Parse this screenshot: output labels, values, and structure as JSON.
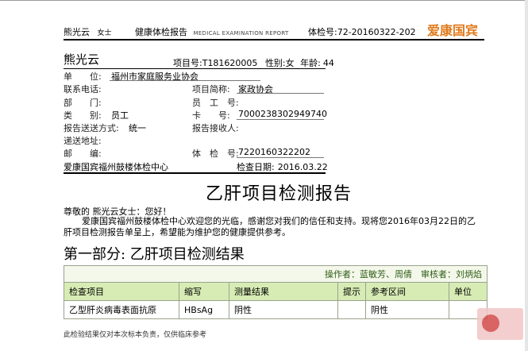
{
  "header": {
    "patient_name": "熊光云",
    "honorific": "女士",
    "report_title": "健康体检报告",
    "report_title_en": "MEDICAL EXAMINATION REPORT",
    "exam_no_label": "体检号:",
    "exam_no": "72-20160322-202",
    "brand": "爱康国宾"
  },
  "info": {
    "name": "熊光云",
    "project_no_label": "项目号:",
    "project_no": "T181620005",
    "gender_label": "性别:",
    "gender": "女",
    "age_label": "年龄:",
    "age": "44",
    "unit_label": "单　　位:",
    "unit": "福州市家庭服务业协会",
    "phone_label": "联系电话:",
    "project_short_label": "项目简称:",
    "project_short": "家政协会",
    "dept_label": "部　　门:",
    "employee_no_label": "员　工　号:",
    "category_label": "类　　别:",
    "category": "员工",
    "card_no_label": "卡　　号:",
    "card_no": "7000238302949740",
    "delivery_label": "报告送送方式:",
    "delivery": "统一",
    "receiver_label": "报告接收人:",
    "address_label": "递送地址:",
    "postcode_label": "邮　　编:",
    "exam_no2_label": "体　检　号:",
    "exam_no2": "7220160322202",
    "center": "爱康国宾福州鼓楼体检中心",
    "exam_date_label": "检查日期:",
    "exam_date": "2016.03.22"
  },
  "main": {
    "title": "乙肝项目检测报告",
    "greeting": "尊敬的 熊光云女士：您好！",
    "intro_line1": "爱康国宾福州鼓楼体检中心欢迎您的光临，感谢您对我们的信任和支持。现将您2016年03月22日的乙",
    "intro_line2": "肝项目检测报告单呈上，希望能为维护您的健康提供参考。",
    "section_title": "第一部分:  乙肝项目检测结果",
    "authors": "操作者：蓝敏芳、周倩　审核者：刘炳焰",
    "footnote": "此检验结果仅对本次标本负责，仅供临床参考"
  },
  "table": {
    "headers": [
      "检查项目",
      "缩写",
      "测量结果",
      "提示",
      "参考区间",
      "单位"
    ],
    "rows": [
      [
        "乙型肝炎病毒表面抗原",
        "HBsAg",
        "阴性",
        "",
        "阴性",
        ""
      ]
    ]
  },
  "colors": {
    "brand": "#e07b1e",
    "table_header_bg": "#d7ecb4",
    "authors_text": "#2d5c16"
  }
}
